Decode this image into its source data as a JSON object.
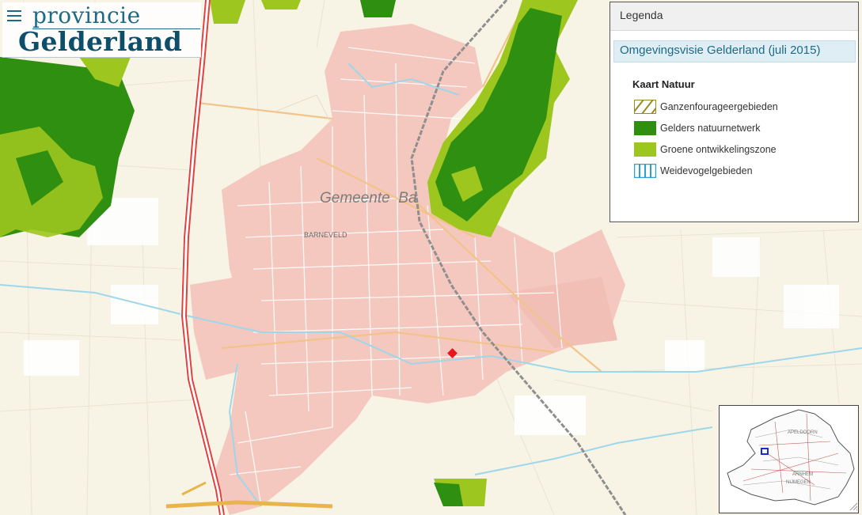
{
  "header": {
    "logo_line1": "provincie",
    "logo_line2": "Gelderland",
    "menu_icon": "hamburger-menu-icon"
  },
  "map": {
    "municipality_label": "Gemeente  Ba",
    "place_label": "BARNEVELD",
    "colors": {
      "urban": "#f4c7bf",
      "rural": "#f7f4e6",
      "nature_network": "#2f8f10",
      "green_zone": "#9dc71f",
      "highway": "#e2413f",
      "water": "#9fd7ea",
      "rail": "#9a9a9a",
      "marker": "#e8141e"
    }
  },
  "legend": {
    "title": "Legenda",
    "layer_title": "Omgevingsvisie Gelderland (juli 2015)",
    "section_title": "Kaart  Natuur",
    "items": [
      {
        "label": "Ganzenfourageergebieden",
        "swatch": "hatch",
        "color": "#9a8a1e"
      },
      {
        "label": "Gelders natuurnetwerk",
        "swatch": "solid",
        "color": "#2f8f10"
      },
      {
        "label": "Groene ontwikkelingszone",
        "swatch": "solid",
        "color": "#9dc71f"
      },
      {
        "label": "Weidevogelgebieden",
        "swatch": "stripes",
        "color": "#2a9fd8"
      }
    ]
  },
  "overview": {
    "labels": [
      "APELDOORN",
      "ARNHEM",
      "NIJMEGEN"
    ]
  }
}
